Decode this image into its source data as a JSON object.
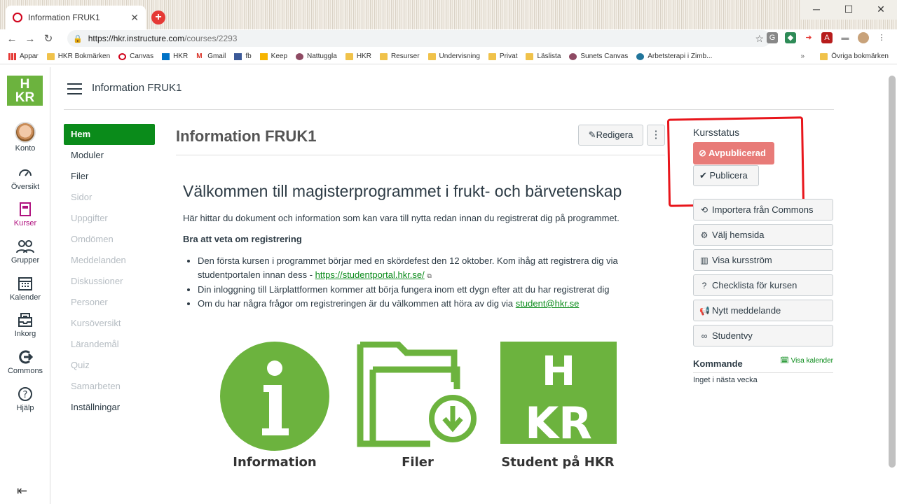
{
  "browser": {
    "tab_title": "Information FRUK1",
    "new_tab": "+",
    "url_host": "https://hkr.instructure.com",
    "url_path": "/courses/2293",
    "bookmarks": [
      "Appar",
      "HKR Bokmärken",
      "Canvas",
      "HKR",
      "Gmail",
      "fb",
      "Keep",
      "Nattuggla",
      "HKR",
      "Resurser",
      "Undervisning",
      "Privat",
      "Läslista",
      "Sunets Canvas",
      "Arbetsterapi i Zimb..."
    ],
    "more_bookmarks": "»",
    "other_bookmarks": "Övriga bokmärken"
  },
  "global_nav": {
    "logo": "HKR",
    "items": [
      {
        "label": "Konto",
        "icon": "avatar"
      },
      {
        "label": "Översikt",
        "icon": "dashboard-icon"
      },
      {
        "label": "Kurser",
        "icon": "courses-icon"
      },
      {
        "label": "Grupper",
        "icon": "groups-icon"
      },
      {
        "label": "Kalender",
        "icon": "calendar-icon"
      },
      {
        "label": "Inkorg",
        "icon": "inbox-icon"
      },
      {
        "label": "Commons",
        "icon": "commons-icon"
      },
      {
        "label": "Hjälp",
        "icon": "help-icon"
      }
    ]
  },
  "breadcrumb": "Information FRUK1",
  "course_nav": {
    "items": [
      {
        "label": "Hem",
        "state": "active"
      },
      {
        "label": "Moduler",
        "state": "visible"
      },
      {
        "label": "Filer",
        "state": "visible"
      },
      {
        "label": "Sidor",
        "state": "hidden"
      },
      {
        "label": "Uppgifter",
        "state": "hidden"
      },
      {
        "label": "Omdömen",
        "state": "hidden"
      },
      {
        "label": "Meddelanden",
        "state": "hidden"
      },
      {
        "label": "Diskussioner",
        "state": "hidden"
      },
      {
        "label": "Personer",
        "state": "hidden"
      },
      {
        "label": "Kursöversikt",
        "state": "hidden"
      },
      {
        "label": "Lärandemål",
        "state": "hidden"
      },
      {
        "label": "Quiz",
        "state": "hidden"
      },
      {
        "label": "Samarbeten",
        "state": "hidden"
      },
      {
        "label": "Inställningar",
        "state": "visible"
      }
    ]
  },
  "page": {
    "title": "Information FRUK1",
    "edit_label": "Redigera",
    "more_label": "⋮",
    "welcome": "Välkommen till magisterprogrammet i frukt- och bärvetenskap",
    "intro": "Här hittar du dokument och information som kan vara till nytta redan innan du registrerat dig på programmet.",
    "bra_heading": "Bra att veta om registrering",
    "bullet1_a": "Den första kursen i programmet börjar med en skördefest den 12 oktober. Kom ihåg att registrera dig via studentportalen innan dess - ",
    "bullet1_link": "https://studentportal.hkr.se/",
    "bullet2": "Din inloggning till Lärplattformen kommer att börja fungera inom ett dygn efter att du har registrerat dig",
    "bullet3_a": "Om du har några frågor om registreringen är du välkommen att höra av dig via ",
    "bullet3_link": "student@hkr.se",
    "tiles": [
      {
        "caption": "Information",
        "icon": "info-icon"
      },
      {
        "caption": "Filer",
        "icon": "folder-download-icon"
      },
      {
        "caption": "Student på HKR",
        "icon": "hkr-logo"
      }
    ],
    "accent_color": "#6cb33e"
  },
  "sidebar": {
    "status_title": "Kursstatus",
    "unpublished": "Avpublicerad",
    "publish": "Publicera",
    "buttons": [
      {
        "label": "Importera från Commons",
        "icon": "import-icon"
      },
      {
        "label": "Välj hemsida",
        "icon": "home-icon"
      },
      {
        "label": "Visa kursström",
        "icon": "stream-icon"
      },
      {
        "label": "Checklista för kursen",
        "icon": "help-icon"
      },
      {
        "label": "Nytt meddelande",
        "icon": "announcement-icon"
      },
      {
        "label": "Studentvy",
        "icon": "glasses-icon"
      }
    ],
    "upcoming_title": "Kommande",
    "view_calendar": "Visa kalender",
    "upcoming_empty": "Inget i nästa vecka"
  }
}
